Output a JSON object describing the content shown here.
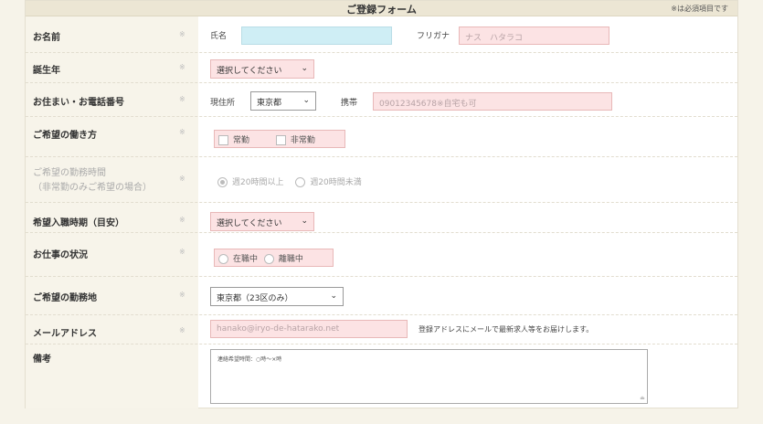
{
  "header": {
    "title": "ご登録フォーム",
    "required_note": "※は必須項目です"
  },
  "required_mark": "※",
  "rows": {
    "name": {
      "label": "お名前",
      "name_label": "氏名",
      "name_value": "",
      "kana_label": "フリガナ",
      "kana_placeholder": "ナス　ハタラコ"
    },
    "birth_year": {
      "label": "誕生年",
      "select_value": "選択してください"
    },
    "address": {
      "label": "お住まい・お電話番号",
      "current_label": "現住所",
      "prefecture_value": "東京都",
      "mobile_label": "携帯",
      "mobile_placeholder": "09012345678※自宅も可"
    },
    "work_style": {
      "label": "ご希望の働き方",
      "options": [
        "常勤",
        "非常勤"
      ]
    },
    "work_hours": {
      "label_line1": "ご希望の勤務時間",
      "label_line2": "（非常勤のみご希望の場合）",
      "options": [
        "週20時間以上",
        "週20時間未満"
      ]
    },
    "start_time": {
      "label": "希望入職時期（目安）",
      "select_value": "選択してください"
    },
    "job_status": {
      "label": "お仕事の状況",
      "options": [
        "在職中",
        "離職中"
      ]
    },
    "location": {
      "label": "ご希望の勤務地",
      "select_value": "東京都（23区のみ）"
    },
    "email": {
      "label": "メールアドレス",
      "placeholder": "hanako@iryo-de-hatarako.net",
      "note": "登録アドレスにメールで最新求人等をお届けします。"
    },
    "remarks": {
      "label": "備考",
      "placeholder": "連絡希望時間：○時～×時"
    }
  }
}
